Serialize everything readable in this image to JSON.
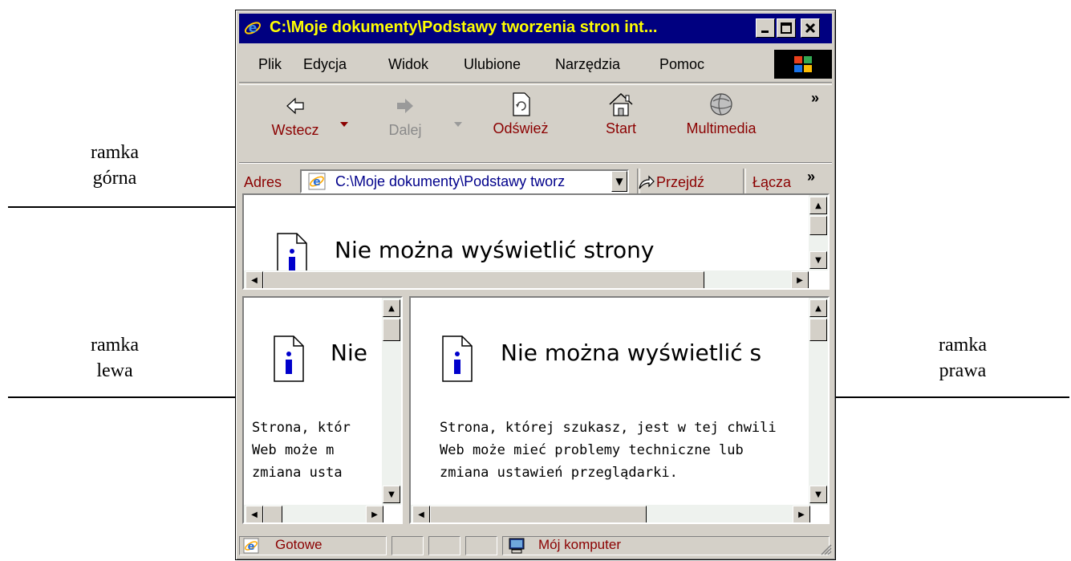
{
  "window": {
    "title": "C:\\Moje dokumenty\\Podstawy tworzenia stron int..."
  },
  "menu": {
    "items": [
      "Plik",
      "Edycja",
      "Widok",
      "Ulubione",
      "Narzędzia",
      "Pomoc"
    ]
  },
  "toolbar": {
    "back_label": "Wstecz",
    "forward_label": "Dalej",
    "refresh_label": "Odśwież",
    "home_label": "Start",
    "media_label": "Multimedia",
    "more": "»"
  },
  "address": {
    "label": "Adres",
    "value": "C:\\Moje dokumenty\\Podstawy tworz",
    "go_label": "Przejdź",
    "links_label": "Łącza",
    "more": "»"
  },
  "frames": {
    "top": {
      "title": "Nie można wyświetlić strony"
    },
    "left": {
      "title": "Nie",
      "body": [
        "Strona, któr",
        "Web może m",
        "zmiana usta"
      ]
    },
    "right": {
      "title": "Nie można wyświetlić s",
      "body": [
        "Strona, której szukasz, jest w tej chwili",
        "Web może mieć problemy techniczne lub",
        "zmiana ustawień przeglądarki."
      ]
    }
  },
  "status": {
    "text": "Gotowe",
    "zone": "Mój komputer"
  },
  "annotations": {
    "top": [
      "ramka",
      "górna"
    ],
    "left": [
      "ramka",
      "lewa"
    ],
    "right": [
      "ramka",
      "prawa"
    ]
  },
  "colors": {
    "titlebar": "#000080",
    "title_text": "#ffff00",
    "chrome": "#d4d0c8",
    "label_text": "#8b0000"
  }
}
